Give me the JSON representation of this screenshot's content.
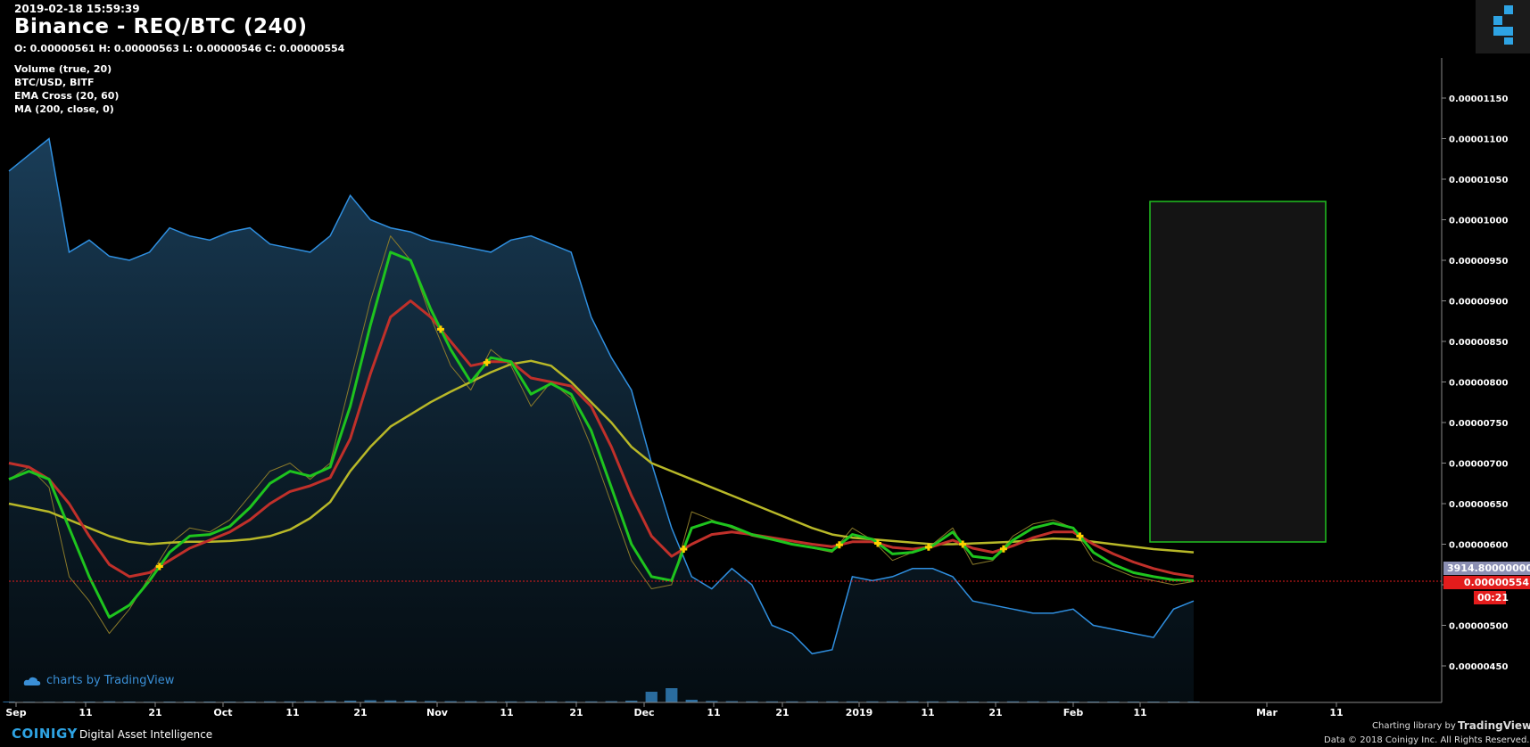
{
  "header": {
    "timestamp": "2019-02-18 15:59:39",
    "title": "Binance - REQ/BTC (240)",
    "ohlc": "O: 0.00000561 H: 0.00000563 L: 0.00000546 C: 0.00000554"
  },
  "indicators": [
    "Volume (true, 20)",
    "BTC/USD, BITF",
    "EMA Cross (20, 60)",
    "MA (200, close, 0)"
  ],
  "tags": {
    "btc_usd": "3914.80000000",
    "last_price": "0.00000554",
    "countdown": "00:21"
  },
  "footer": {
    "tv_badge": "charts by TradingView",
    "brand": "COINIGY",
    "tagline": "Digital Asset Intelligence",
    "lib_credit": "Charting library by",
    "tv_name": "TradingView",
    "data_credit": "Data © 2018 Coinigy Inc. All Rights Reserved."
  },
  "colors": {
    "background": "#000000",
    "btc_line": "#2f8fe0",
    "ema_fast": "#1ec41e",
    "ema_slow": "#c0302a",
    "ma200": "#b8b828",
    "price_line": "#e31c1c",
    "rect_border": "#20c020"
  },
  "chart_data": {
    "type": "line",
    "x_tick_labels": [
      "Sep",
      "11",
      "21",
      "Oct",
      "11",
      "21",
      "Nov",
      "11",
      "21",
      "Dec",
      "11",
      "21",
      "2019",
      "11",
      "21",
      "Feb",
      "11",
      "Mar",
      "11"
    ],
    "y_tick_labels": [
      "0.00001150",
      "0.00001100",
      "0.00001050",
      "0.00001000",
      "0.00000950",
      "0.00000900",
      "0.00000850",
      "0.00000800",
      "0.00000750",
      "0.00000700",
      "0.00000650",
      "0.00000600",
      "0.00000550",
      "0.00000500",
      "0.00000450"
    ],
    "ylim": [
      4.25e-06,
      1.19e-05
    ],
    "last_price": 5.54e-06,
    "series": [
      {
        "key": "price",
        "values": [
          6.8e-06,
          6.95e-06,
          6.7e-06,
          5.6e-06,
          5.3e-06,
          4.9e-06,
          5.2e-06,
          5.6e-06,
          6e-06,
          6.2e-06,
          6.15e-06,
          6.3e-06,
          6.6e-06,
          6.9e-06,
          7e-06,
          6.8e-06,
          7e-06,
          8e-06,
          9e-06,
          9.8e-06,
          9.5e-06,
          8.8e-06,
          8.2e-06,
          7.9e-06,
          8.4e-06,
          8.2e-06,
          7.7e-06,
          8e-06,
          7.8e-06,
          7.2e-06,
          6.5e-06,
          5.8e-06,
          5.45e-06,
          5.5e-06,
          6.4e-06,
          6.3e-06,
          6.2e-06,
          6.1e-06,
          6.05e-06,
          6e-06,
          5.95e-06,
          5.9e-06,
          6.2e-06,
          6.05e-06,
          5.8e-06,
          5.9e-06,
          6e-06,
          6.2e-06,
          5.75e-06,
          5.8e-06,
          6.1e-06,
          6.25e-06,
          6.3e-06,
          6.2e-06,
          5.8e-06,
          5.7e-06,
          5.6e-06,
          5.55e-06,
          5.5e-06,
          5.54e-06
        ]
      },
      {
        "key": "ema_fast",
        "values": [
          6.8e-06,
          6.9e-06,
          6.8e-06,
          6.2e-06,
          5.6e-06,
          5.1e-06,
          5.25e-06,
          5.55e-06,
          5.9e-06,
          6.1e-06,
          6.12e-06,
          6.22e-06,
          6.45e-06,
          6.75e-06,
          6.9e-06,
          6.84e-06,
          6.95e-06,
          7.7e-06,
          8.7e-06,
          9.6e-06,
          9.5e-06,
          8.9e-06,
          8.4e-06,
          8e-06,
          8.3e-06,
          8.25e-06,
          7.85e-06,
          7.98e-06,
          7.85e-06,
          7.4e-06,
          6.7e-06,
          6e-06,
          5.6e-06,
          5.55e-06,
          6.2e-06,
          6.28e-06,
          6.22e-06,
          6.12e-06,
          6.06e-06,
          6e-06,
          5.96e-06,
          5.92e-06,
          6.12e-06,
          6.06e-06,
          5.88e-06,
          5.9e-06,
          5.98e-06,
          6.15e-06,
          5.85e-06,
          5.82e-06,
          6.05e-06,
          6.2e-06,
          6.26e-06,
          6.2e-06,
          5.9e-06,
          5.75e-06,
          5.65e-06,
          5.6e-06,
          5.56e-06,
          5.55e-06
        ]
      },
      {
        "key": "ema_slow",
        "values": [
          7e-06,
          6.95e-06,
          6.8e-06,
          6.5e-06,
          6.1e-06,
          5.75e-06,
          5.6e-06,
          5.65e-06,
          5.8e-06,
          5.95e-06,
          6.05e-06,
          6.15e-06,
          6.3e-06,
          6.5e-06,
          6.65e-06,
          6.72e-06,
          6.82e-06,
          7.3e-06,
          8.1e-06,
          8.8e-06,
          9e-06,
          8.8e-06,
          8.5e-06,
          8.2e-06,
          8.25e-06,
          8.25e-06,
          8.05e-06,
          8e-06,
          7.95e-06,
          7.7e-06,
          7.2e-06,
          6.6e-06,
          6.1e-06,
          5.85e-06,
          6e-06,
          6.12e-06,
          6.15e-06,
          6.12e-06,
          6.08e-06,
          6.04e-06,
          6e-06,
          5.97e-06,
          6.03e-06,
          6.03e-06,
          5.96e-06,
          5.94e-06,
          5.97e-06,
          6.05e-06,
          5.95e-06,
          5.9e-06,
          5.98e-06,
          6.08e-06,
          6.15e-06,
          6.15e-06,
          6e-06,
          5.88e-06,
          5.78e-06,
          5.7e-06,
          5.64e-06,
          5.6e-06
        ]
      },
      {
        "key": "ma200",
        "values": [
          6.5e-06,
          6.45e-06,
          6.4e-06,
          6.3e-06,
          6.2e-06,
          6.1e-06,
          6.03e-06,
          6e-06,
          6.02e-06,
          6.03e-06,
          6.03e-06,
          6.04e-06,
          6.06e-06,
          6.1e-06,
          6.18e-06,
          6.32e-06,
          6.52e-06,
          6.9e-06,
          7.2e-06,
          7.45e-06,
          7.6e-06,
          7.75e-06,
          7.88e-06,
          8e-06,
          8.12e-06,
          8.22e-06,
          8.26e-06,
          8.2e-06,
          8e-06,
          7.75e-06,
          7.5e-06,
          7.2e-06,
          7e-06,
          6.9e-06,
          6.8e-06,
          6.7e-06,
          6.6e-06,
          6.5e-06,
          6.4e-06,
          6.3e-06,
          6.2e-06,
          6.12e-06,
          6.08e-06,
          6.06e-06,
          6.04e-06,
          6.02e-06,
          6e-06,
          6e-06,
          6.01e-06,
          6.02e-06,
          6.03e-06,
          6.05e-06,
          6.07e-06,
          6.06e-06,
          6.03e-06,
          6e-06,
          5.97e-06,
          5.94e-06,
          5.92e-06,
          5.9e-06
        ]
      },
      {
        "key": "btc_usd",
        "values": [
          1.06e-05,
          1.08e-05,
          1.1e-05,
          9.6e-06,
          9.75e-06,
          9.55e-06,
          9.5e-06,
          9.6e-06,
          9.9e-06,
          9.8e-06,
          9.75e-06,
          9.85e-06,
          9.9e-06,
          9.7e-06,
          9.65e-06,
          9.6e-06,
          9.8e-06,
          1.03e-05,
          1e-05,
          9.9e-06,
          9.85e-06,
          9.75e-06,
          9.7e-06,
          9.65e-06,
          9.6e-06,
          9.75e-06,
          9.8e-06,
          9.7e-06,
          9.6e-06,
          8.8e-06,
          8.3e-06,
          7.9e-06,
          7e-06,
          6.2e-06,
          5.6e-06,
          5.45e-06,
          5.7e-06,
          5.5e-06,
          5e-06,
          4.9e-06,
          4.65e-06,
          4.7e-06,
          5.6e-06,
          5.55e-06,
          5.6e-06,
          5.7e-06,
          5.7e-06,
          5.6e-06,
          5.3e-06,
          5.25e-06,
          5.2e-06,
          5.15e-06,
          5.15e-06,
          5.2e-06,
          5e-06,
          4.95e-06,
          4.9e-06,
          4.85e-06,
          5.2e-06,
          5.3e-06
        ]
      }
    ],
    "volume": [
      0.05,
      0.04,
      0.04,
      0.05,
      0.05,
      0.06,
      0.05,
      0.04,
      0.05,
      0.05,
      0.05,
      0.05,
      0.05,
      0.06,
      0.06,
      0.07,
      0.08,
      0.1,
      0.12,
      0.11,
      0.1,
      0.08,
      0.07,
      0.07,
      0.06,
      0.06,
      0.06,
      0.06,
      0.06,
      0.06,
      0.07,
      0.1,
      0.6,
      0.8,
      0.15,
      0.08,
      0.07,
      0.06,
      0.06,
      0.06,
      0.06,
      0.06,
      0.06,
      0.06,
      0.06,
      0.06,
      0.06,
      0.06,
      0.05,
      0.05,
      0.06,
      0.06,
      0.06,
      0.05,
      0.05,
      0.05,
      0.05,
      0.05,
      0.05,
      0.05
    ],
    "grid": false,
    "legend": "top-left"
  }
}
